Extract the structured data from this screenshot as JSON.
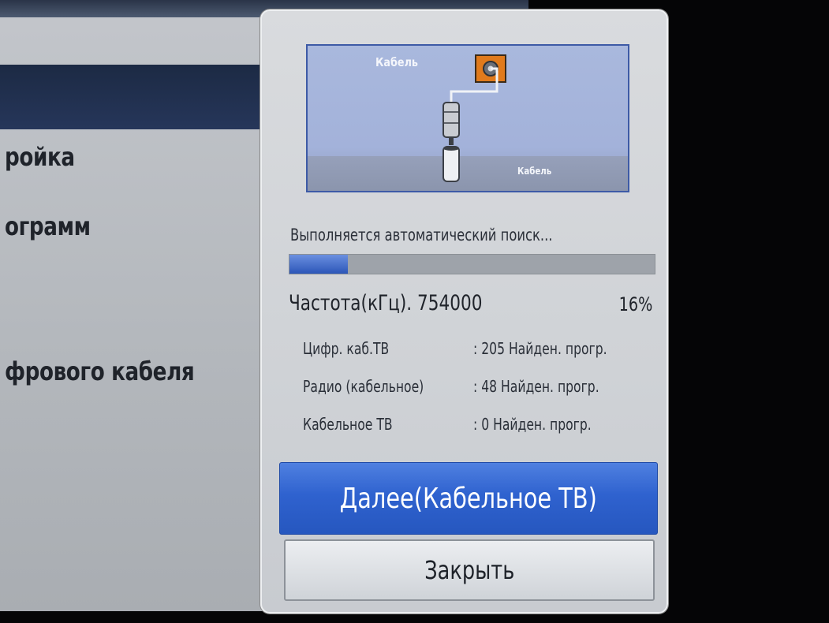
{
  "background_menu": {
    "items": [
      "ройка",
      "ограмм",
      "фрового кабеля"
    ]
  },
  "popup": {
    "diagram": {
      "top_label": "Кабель",
      "bottom_label": "Кабель"
    },
    "status": "Выполняется автоматический поиск...",
    "progress_fraction": 0.16,
    "frequency": "Частота(кГц). 754000",
    "percent": "16%",
    "rows": [
      {
        "label": "Цифр. каб.ТВ",
        "value": ": 205 Найден. прогр."
      },
      {
        "label": "Радио (кабельное)",
        "value": ": 48 Найден. прогр."
      },
      {
        "label": "Кабельное ТВ",
        "value": ": 0 Найден. прогр."
      }
    ],
    "next_button": "Далее(Кабельное ТВ)",
    "close_button": "Закрыть"
  },
  "colors": {
    "accent": "#2f62cf",
    "connector": "#e07a1c"
  }
}
